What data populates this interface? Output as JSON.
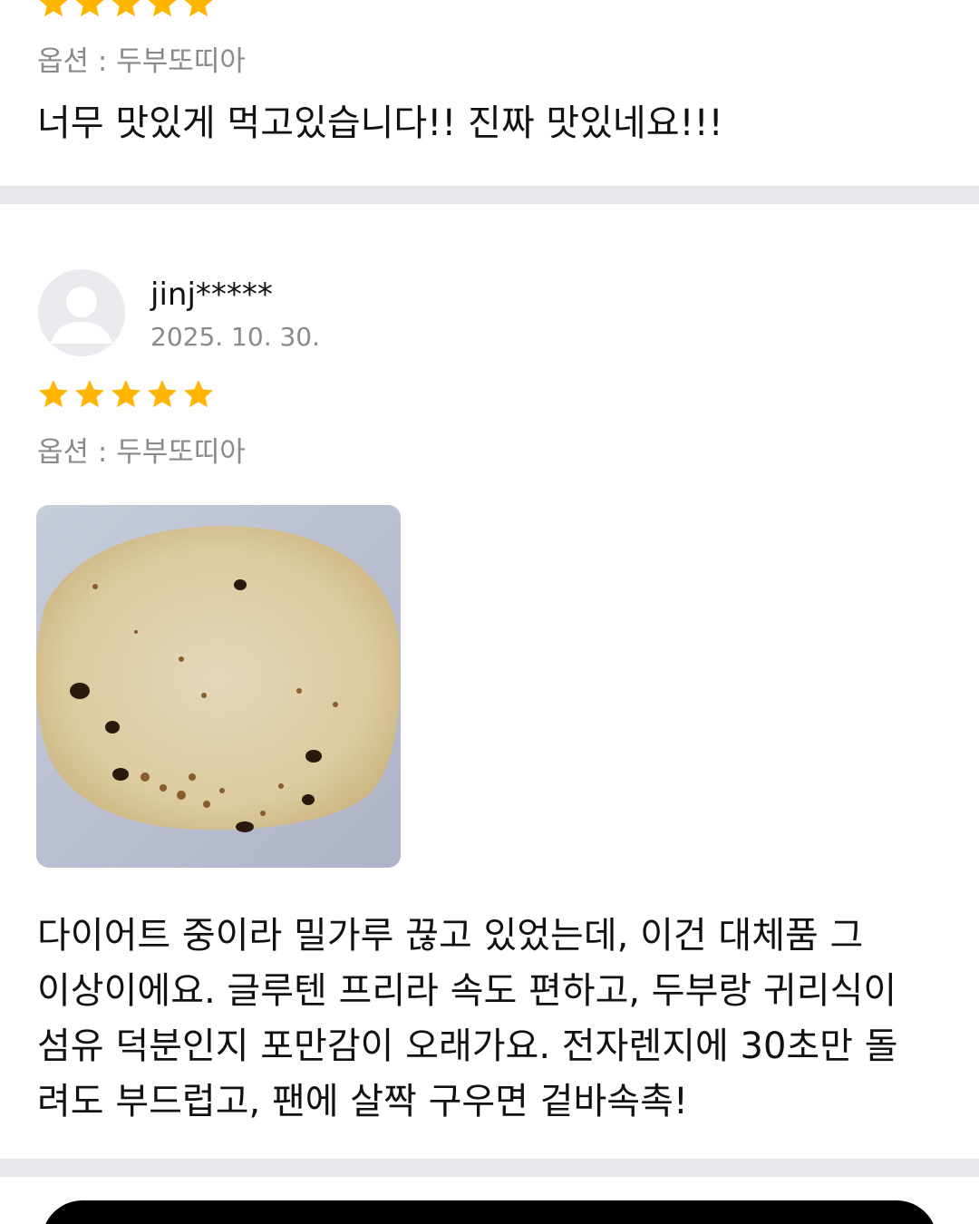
{
  "reviews": [
    {
      "rating": 5,
      "option": "옵션 : 두부또띠아",
      "text": "너무 맛있게 먹고있습니다!! 진짜 맛있네요!!!"
    },
    {
      "user": "jinj*****",
      "date": "2025. 10. 30.",
      "rating": 5,
      "option": "옵션 : 두부또띠아",
      "text_lines": [
        "다이어트 중이라 밀가루 끊고 있었는데, 이건 대체품 그",
        "이상이에요. 글루텐 프리라 속도 편하고, 두부랑 귀리식이",
        "섬유 덕분인지 포만감이 오래가요. 전자렌지에 30초만 돌",
        "려도 부드럽고, 팬에 살짝 구우면 겉바속촉!"
      ]
    }
  ],
  "colors": {
    "star": "#FFB400",
    "divider": "#E6E7EA",
    "muted_text": "#8A8A8A",
    "avatar_bg": "#E9EAED"
  },
  "icons": [
    "star-icon",
    "default-avatar-icon"
  ]
}
